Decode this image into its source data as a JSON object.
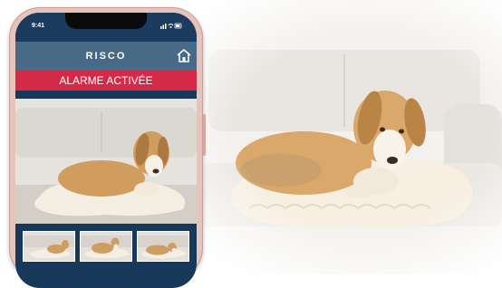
{
  "status_bar": {
    "time": "9:41"
  },
  "header": {
    "logo": "RISCO"
  },
  "alarm": {
    "label": "ALARME ACTIVÉE"
  },
  "colors": {
    "header": "#476a86",
    "screen_background": "#18385a",
    "alarm_banner": "#d42a48",
    "phone_frame": "#e7c4bb"
  },
  "icons": [
    "home-icon",
    "wifi-icon",
    "battery-icon",
    "signal-icon"
  ],
  "snapshots": {
    "count": 3
  }
}
